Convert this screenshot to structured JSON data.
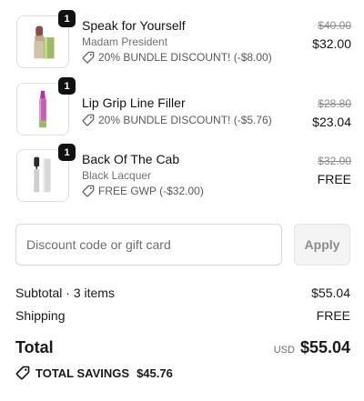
{
  "items": [
    {
      "quantity": "1",
      "name": "Speak for Yourself",
      "variant": "Madam President",
      "discount": "20% BUNDLE DISCOUNT! (-$8.00)",
      "original_price": "$40.00",
      "price": "$32.00",
      "thumbnail": "lipstick"
    },
    {
      "quantity": "1",
      "name": "Lip Grip Line Filler",
      "variant": "",
      "discount": "20% BUNDLE DISCOUNT! (-$5.76)",
      "original_price": "$28.80",
      "price": "$23.04",
      "thumbnail": "lip-liner"
    },
    {
      "quantity": "1",
      "name": "Back Of The Cab",
      "variant": "Black Lacquer",
      "discount": "FREE GWP (-$32.00)",
      "original_price": "$32.00",
      "price": "FREE",
      "thumbnail": "mascara"
    }
  ],
  "discount_code": {
    "placeholder": "Discount code or gift card",
    "value": "",
    "apply_label": "Apply"
  },
  "summary": {
    "subtotal_label": "Subtotal · 3 items",
    "subtotal_value": "$55.04",
    "shipping_label": "Shipping",
    "shipping_value": "FREE",
    "total_label": "Total",
    "currency": "USD",
    "total_value": "$55.04",
    "savings_label": "TOTAL SAVINGS",
    "savings_value": "$45.76"
  },
  "icons": {
    "discount_tag": "tag-icon"
  },
  "colors": {
    "text": "#141414",
    "muted": "#707070",
    "border": "#dedede",
    "badge": "#111111"
  }
}
